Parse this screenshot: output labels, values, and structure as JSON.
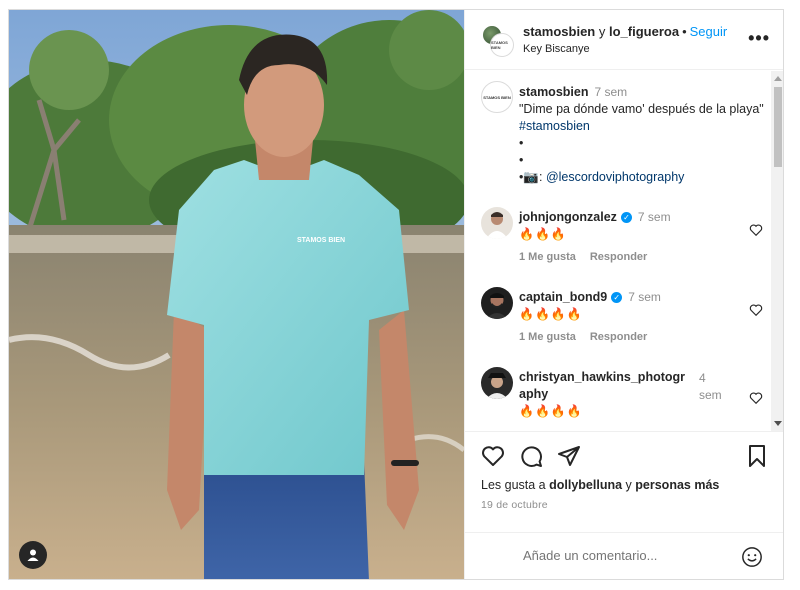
{
  "header": {
    "user1": "stamosbien",
    "conj": "y",
    "user2": "lo_figueroa",
    "follow_label": "Seguir",
    "location": "Key Biscanye",
    "more_label": "•••"
  },
  "avatar_text": "STAMOS BIEN",
  "caption": {
    "username": "stamosbien",
    "time": "7 sem",
    "text": "\"Dime pa dónde vamo' después de la playa\"",
    "hashtag": "#stamosbien",
    "bullet1": "•",
    "bullet2": "•",
    "bullet3": "•",
    "camera_emoji": "📷",
    "mention_prefix": ":",
    "mention": "@lescordoviphotography"
  },
  "comments": [
    {
      "username": "johnjongonzalez",
      "verified": true,
      "time": "7 sem",
      "text": "🔥🔥🔥",
      "likes": "1 Me gusta",
      "reply": "Responder"
    },
    {
      "username": "captain_bond9",
      "verified": true,
      "time": "7 sem",
      "text": "🔥🔥🔥🔥",
      "likes": "1 Me gusta",
      "reply": "Responder"
    },
    {
      "username": "christyan_hawkins_photography",
      "verified": false,
      "time": "4 sem",
      "text": "🔥🔥🔥🔥",
      "likes": "",
      "reply": ""
    }
  ],
  "comment3_name_line1": "christyan_hawkins_photogr",
  "comment3_name_line2": "aphy",
  "comment3_time_line1": "4",
  "comment3_time_line2": "sem",
  "likes": {
    "prefix": "Les gusta a",
    "user": "dollybelluna",
    "suffix": "y",
    "others": "personas más"
  },
  "date": "19 de octubre",
  "add_comment_placeholder": "Añade un comentario...",
  "colors": {
    "accent": "#0095f6",
    "link": "#00376b",
    "muted": "#8e8e8e"
  }
}
